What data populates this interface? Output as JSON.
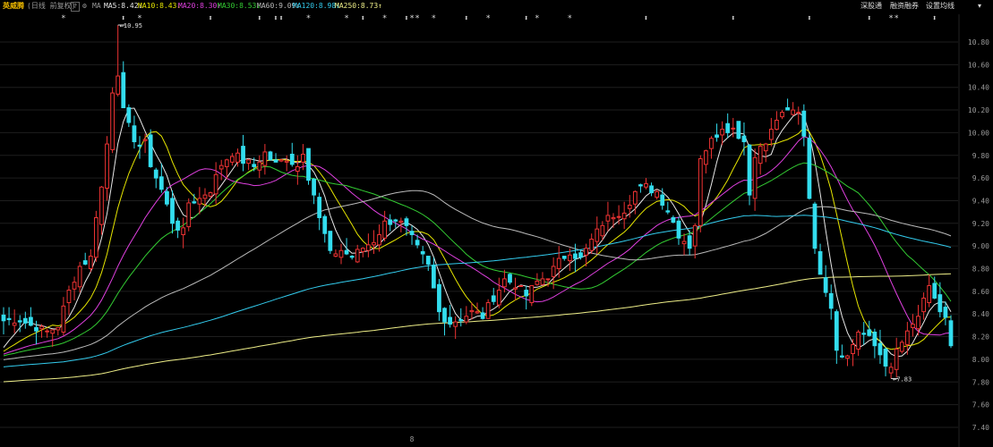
{
  "topbar": {
    "stock_name": "英威腾",
    "period": "(日线 前复权)",
    "help": "?",
    "ma_label": "MA",
    "ma_items": [
      {
        "text": "MA5:8.42",
        "arrow": "↓",
        "color": "#e8e8e8"
      },
      {
        "text": "MA10:8.43",
        "arrow": "↓",
        "color": "#e6e600"
      },
      {
        "text": "MA20:8.30",
        "arrow": "↑",
        "color": "#e040e0"
      },
      {
        "text": "MA30:8.53",
        "arrow": "↓",
        "color": "#33cc33"
      },
      {
        "text": "MA60:9.09",
        "arrow": "↓",
        "color": "#bbbbbb"
      },
      {
        "text": "MA120:8.98",
        "arrow": "↓",
        "color": "#33ccee"
      },
      {
        "text": "MA250:8.73",
        "arrow": "↑",
        "color": "#eeee88"
      }
    ],
    "right_buttons": [
      "深股通",
      "融资融券",
      "设置均线"
    ],
    "down_arrow": "▾"
  },
  "chart_data": {
    "type": "candlestick",
    "title": "英威腾",
    "subtitle": "日线 前复权",
    "ylim": [
      7.4,
      10.95
    ],
    "y_ticks": [
      10.8,
      10.6,
      10.4,
      10.2,
      10.0,
      9.8,
      9.6,
      9.4,
      9.2,
      9.0,
      8.8,
      8.6,
      8.4,
      8.2,
      8.0,
      7.8,
      7.6,
      7.4
    ],
    "colors": {
      "up": "#ee3333",
      "down": "#33ddee",
      "grid": "#1e1e1e"
    },
    "annotations": [
      {
        "label": "10.95",
        "arrow": "←",
        "x_index": 21,
        "y": 10.95
      },
      {
        "label": "7.83",
        "arrow": "←",
        "x_index": 163,
        "y": 7.83
      }
    ],
    "event_marks": [
      {
        "symbol": "*",
        "x_index": 11
      },
      {
        "symbol": "⬍",
        "x_index": 22
      },
      {
        "symbol": "*",
        "x_index": 25
      },
      {
        "symbol": "⬍",
        "x_index": 38
      },
      {
        "symbol": "⬍",
        "x_index": 47
      },
      {
        "symbol": "⬍",
        "x_index": 50
      },
      {
        "symbol": "⬍",
        "x_index": 51
      },
      {
        "symbol": "*",
        "x_index": 56
      },
      {
        "symbol": "*",
        "x_index": 63
      },
      {
        "symbol": "⬍",
        "x_index": 66
      },
      {
        "symbol": "*",
        "x_index": 70
      },
      {
        "symbol": "⬍",
        "x_index": 74
      },
      {
        "symbol": "*",
        "x_index": 75
      },
      {
        "symbol": "*",
        "x_index": 76
      },
      {
        "symbol": "*",
        "x_index": 79
      },
      {
        "symbol": "⬍",
        "x_index": 85
      },
      {
        "symbol": "*",
        "x_index": 89
      },
      {
        "symbol": "⬍",
        "x_index": 96
      },
      {
        "symbol": "*",
        "x_index": 98
      },
      {
        "symbol": "*",
        "x_index": 104
      },
      {
        "symbol": "⬍",
        "x_index": 118
      },
      {
        "symbol": "⬍",
        "x_index": 134
      },
      {
        "symbol": "⬍",
        "x_index": 148
      },
      {
        "symbol": "⬍",
        "x_index": 159
      },
      {
        "symbol": "*",
        "x_index": 163
      },
      {
        "symbol": "*",
        "x_index": 164
      },
      {
        "symbol": "⬍",
        "x_index": 171
      }
    ],
    "bottom_marker": {
      "text": "8",
      "x_index": 75,
      "color": "#dd2222"
    },
    "candles": [],
    "ma_lines": [
      {
        "name": "MA5",
        "color": "#e8e8e8",
        "period": 5,
        "values": []
      },
      {
        "name": "MA10",
        "color": "#e6e600",
        "period": 10,
        "values": []
      },
      {
        "name": "MA20",
        "color": "#e040e0",
        "period": 20,
        "values": []
      },
      {
        "name": "MA30",
        "color": "#33cc33",
        "period": 30,
        "values": []
      },
      {
        "name": "MA60",
        "color": "#bbbbbb",
        "period": 60,
        "values": []
      },
      {
        "name": "MA120",
        "color": "#33ccee",
        "period": 120,
        "values": []
      },
      {
        "name": "MA250",
        "color": "#eeee88",
        "period": 250,
        "values": []
      }
    ],
    "close_waypoints": [
      [
        0,
        8.34
      ],
      [
        3,
        8.35
      ],
      [
        5,
        8.3
      ],
      [
        8,
        8.24
      ],
      [
        10,
        8.3
      ],
      [
        12,
        8.6
      ],
      [
        14,
        8.82
      ],
      [
        16,
        8.9
      ],
      [
        17,
        9.28
      ],
      [
        18,
        9.52
      ],
      [
        19,
        9.9
      ],
      [
        20,
        10.38
      ],
      [
        21,
        10.5
      ],
      [
        22,
        10.18
      ],
      [
        23,
        10.05
      ],
      [
        24,
        9.95
      ],
      [
        25,
        9.88
      ],
      [
        26,
        9.9
      ],
      [
        27,
        9.72
      ],
      [
        29,
        9.5
      ],
      [
        31,
        9.22
      ],
      [
        33,
        9.12
      ],
      [
        34,
        9.38
      ],
      [
        36,
        9.42
      ],
      [
        38,
        9.5
      ],
      [
        40,
        9.72
      ],
      [
        42,
        9.82
      ],
      [
        44,
        9.75
      ],
      [
        46,
        9.7
      ],
      [
        48,
        9.82
      ],
      [
        50,
        9.72
      ],
      [
        52,
        9.78
      ],
      [
        54,
        9.7
      ],
      [
        55,
        9.84
      ],
      [
        56,
        9.62
      ],
      [
        57,
        9.46
      ],
      [
        58,
        9.24
      ],
      [
        59,
        9.1
      ],
      [
        60,
        8.92
      ],
      [
        62,
        8.96
      ],
      [
        64,
        8.9
      ],
      [
        66,
        8.98
      ],
      [
        68,
        9.05
      ],
      [
        70,
        9.2
      ],
      [
        72,
        9.24
      ],
      [
        74,
        9.15
      ],
      [
        76,
        8.98
      ],
      [
        78,
        8.82
      ],
      [
        80,
        8.42
      ],
      [
        82,
        8.32
      ],
      [
        84,
        8.36
      ],
      [
        86,
        8.42
      ],
      [
        88,
        8.38
      ],
      [
        90,
        8.55
      ],
      [
        92,
        8.7
      ],
      [
        94,
        8.66
      ],
      [
        96,
        8.56
      ],
      [
        98,
        8.68
      ],
      [
        100,
        8.74
      ],
      [
        102,
        8.86
      ],
      [
        104,
        8.96
      ],
      [
        106,
        8.88
      ],
      [
        108,
        9.05
      ],
      [
        110,
        9.2
      ],
      [
        112,
        9.28
      ],
      [
        114,
        9.32
      ],
      [
        116,
        9.48
      ],
      [
        118,
        9.52
      ],
      [
        120,
        9.48
      ],
      [
        122,
        9.32
      ],
      [
        124,
        9.1
      ],
      [
        126,
        9.0
      ],
      [
        127,
        9.2
      ],
      [
        128,
        9.75
      ],
      [
        130,
        9.98
      ],
      [
        132,
        10.02
      ],
      [
        134,
        10.05
      ],
      [
        136,
        9.92
      ],
      [
        137,
        9.46
      ],
      [
        138,
        9.82
      ],
      [
        140,
        9.9
      ],
      [
        142,
        10.12
      ],
      [
        144,
        10.18
      ],
      [
        146,
        10.2
      ],
      [
        147,
        9.98
      ],
      [
        148,
        9.45
      ],
      [
        149,
        8.95
      ],
      [
        150,
        8.78
      ],
      [
        151,
        8.62
      ],
      [
        152,
        8.48
      ],
      [
        153,
        8.1
      ],
      [
        155,
        8.02
      ],
      [
        157,
        8.25
      ],
      [
        159,
        8.18
      ],
      [
        161,
        8.05
      ],
      [
        163,
        7.9
      ],
      [
        164,
        8.08
      ],
      [
        166,
        8.22
      ],
      [
        168,
        8.38
      ],
      [
        170,
        8.62
      ],
      [
        171,
        8.55
      ],
      [
        172,
        8.42
      ],
      [
        173,
        8.35
      ],
      [
        174,
        8.1
      ]
    ]
  }
}
